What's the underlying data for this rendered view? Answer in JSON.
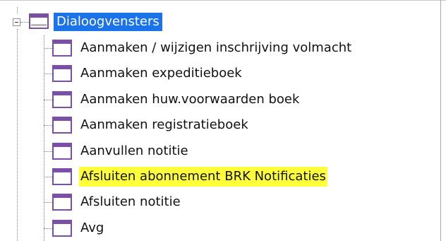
{
  "tree": {
    "root": {
      "label": "Dialoogvensters",
      "expanded": true,
      "selected": true,
      "icon": "window-icon"
    },
    "children": [
      {
        "label": "Aanmaken / wijzigen inschrijving volmacht",
        "icon": "window-icon",
        "highlighted": false
      },
      {
        "label": "Aanmaken expeditieboek",
        "icon": "window-icon",
        "highlighted": false
      },
      {
        "label": "Aanmaken huw.voorwaarden boek",
        "icon": "window-icon",
        "highlighted": false
      },
      {
        "label": "Aanmaken registratieboek",
        "icon": "window-icon",
        "highlighted": false
      },
      {
        "label": "Aanvullen notitie",
        "icon": "window-icon",
        "highlighted": false
      },
      {
        "label": "Afsluiten abonnement BRK Notificaties",
        "icon": "window-icon",
        "highlighted": true
      },
      {
        "label": "Afsluiten notitie",
        "icon": "window-icon",
        "highlighted": false
      },
      {
        "label": "Avg",
        "icon": "window-icon",
        "highlighted": false
      }
    ]
  },
  "colors": {
    "selection": "#1a73e8",
    "highlight": "#ffff3a",
    "icon_accent": "#7b4fa6"
  }
}
